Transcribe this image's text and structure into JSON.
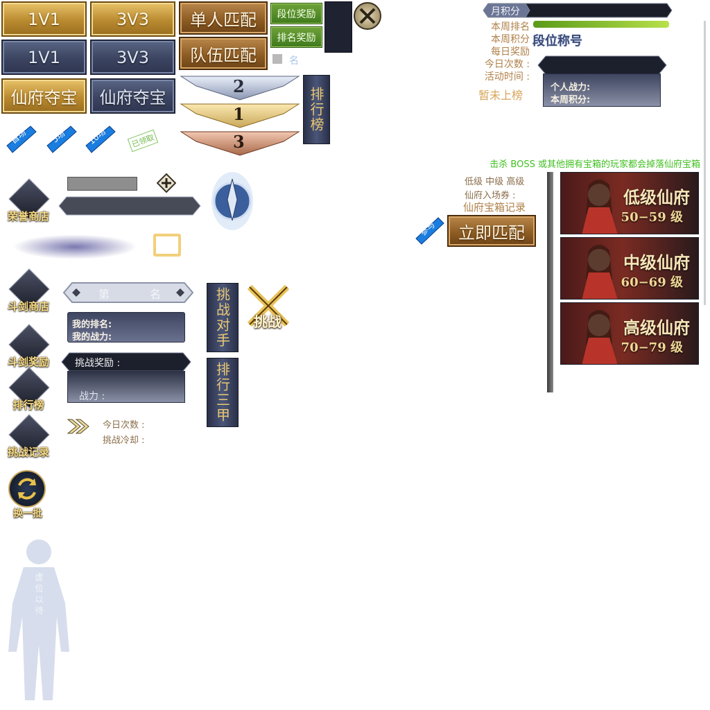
{
  "mode_buttons": {
    "gold_1v1": "1V1",
    "gold_3v3": "3V3",
    "slate_1v1": "1V1",
    "slate_3v3": "3V3",
    "gold_xianfu": "仙府夺宝",
    "slate_xianfu": "仙府夺宝"
  },
  "match_buttons": {
    "solo": "单人匹配",
    "team": "队伍匹配",
    "rank_reward": "段位奖励",
    "ranking_reward": "排名奖励"
  },
  "rank_marker": "名",
  "podium": [
    "2",
    "1",
    "3"
  ],
  "leaderboard_tab": "排行榜",
  "ribbons": [
    "首场",
    "5场",
    "10场"
  ],
  "claimed_stamp": "已领取",
  "honor_shop": "荣誉商店",
  "rank_slot": {
    "first": "第",
    "last": "名"
  },
  "my_info": {
    "rank_label": "我的排名:",
    "power_label": "我的战力:"
  },
  "challenge_reward_label": "挑战奖励 :",
  "power_label": "战力 :",
  "challenge_opponent_tab": "挑战对手",
  "challenge_badge": "挑战",
  "top3_tab": "排行三甲",
  "left_menu": [
    "斗剑商店",
    "斗剑奖励",
    "排行榜",
    "挑战记录"
  ],
  "daily_count_label": "今日次数 :",
  "cooldown_label": "挑战冷却 :",
  "refresh_label": "换一批",
  "silhouette_text": "虚位以待",
  "monthly": {
    "header": "月积分",
    "labels": [
      "本周排名",
      "本周积分",
      "每日奖励",
      "今日次数 :",
      "活动时间 :"
    ],
    "title_label": "段位称号",
    "not_ranked": "暂未上榜",
    "panel_power": "个人战力:",
    "panel_points": "本周积分:"
  },
  "xianfu": {
    "notice": "击杀 BOSS 或其他拥有宝箱的玩家都会掉落仙府宝箱",
    "levels_line": "低级 中级 高级",
    "ticket_label": "仙府入场券 :",
    "chest_record": "仙府宝箱记录",
    "join_ribbon": "参与",
    "match_now": "立即匹配",
    "cards": [
      {
        "title": "低级仙府",
        "range": "50−59 级"
      },
      {
        "title": "中级仙府",
        "range": "60−69 级"
      },
      {
        "title": "高级仙府",
        "range": "70−79 级"
      }
    ]
  },
  "colors": {
    "gold": "#c79a3f",
    "slate": "#3b4460",
    "notice_green": "#3fbf1f",
    "label_tan": "#b0814a"
  }
}
